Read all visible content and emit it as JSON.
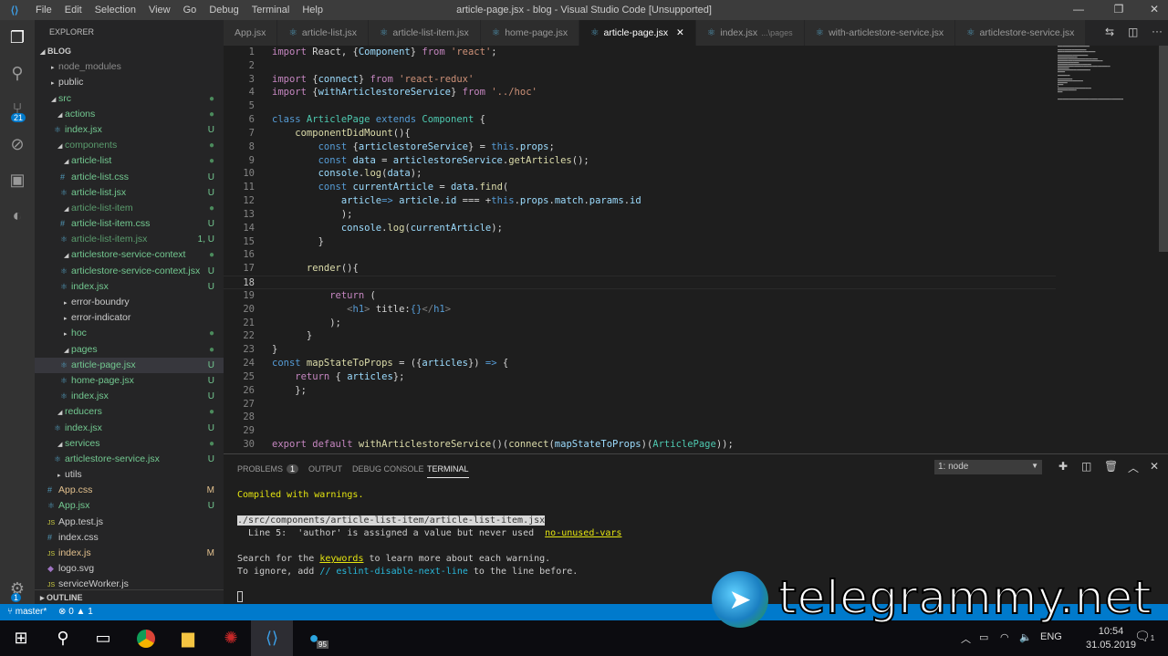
{
  "window": {
    "title": "article-page.jsx - blog - Visual Studio Code [Unsupported]",
    "menu": [
      "File",
      "Edit",
      "Selection",
      "View",
      "Go",
      "Debug",
      "Terminal",
      "Help"
    ]
  },
  "activity": {
    "items": [
      "explorer-icon",
      "search-icon",
      "source-control-icon",
      "debug-icon",
      "extensions-icon",
      "git-icon"
    ],
    "scm_badge": "21",
    "settings_badge": "1"
  },
  "sidebar": {
    "title": "EXPLORER",
    "root": "BLOG",
    "outline": "OUTLINE",
    "tree": [
      {
        "name": "node_modules",
        "depth": 0,
        "kind": "closed",
        "color": "#8b8b8b"
      },
      {
        "name": "public",
        "depth": 0,
        "kind": "closed",
        "color": "#ccc"
      },
      {
        "name": "src",
        "depth": 0,
        "kind": "open",
        "color": "#73c991",
        "deco": "●"
      },
      {
        "name": "actions",
        "depth": 1,
        "kind": "open",
        "color": "#73c991",
        "deco": "●"
      },
      {
        "name": "index.jsx",
        "depth": 1,
        "kind": "react",
        "color": "#73c991",
        "deco": "U"
      },
      {
        "name": "components",
        "depth": 1,
        "kind": "open",
        "color": "#5a9c6d",
        "deco": "●"
      },
      {
        "name": "article-list",
        "depth": 2,
        "kind": "open",
        "color": "#73c991",
        "deco": "●"
      },
      {
        "name": "article-list.css",
        "depth": 2,
        "kind": "css",
        "color": "#73c991",
        "deco": "U"
      },
      {
        "name": "article-list.jsx",
        "depth": 2,
        "kind": "react",
        "color": "#73c991",
        "deco": "U"
      },
      {
        "name": "article-list-item",
        "depth": 2,
        "kind": "open",
        "color": "#5a9c6d",
        "deco": "●"
      },
      {
        "name": "article-list-item.css",
        "depth": 2,
        "kind": "css",
        "color": "#73c991",
        "deco": "U"
      },
      {
        "name": "article-list-item.jsx",
        "depth": 2,
        "kind": "react",
        "color": "#5a9c6d",
        "deco": "1, U"
      },
      {
        "name": "articlestore-service-context",
        "depth": 2,
        "kind": "open",
        "color": "#73c991",
        "deco": "●"
      },
      {
        "name": "articlestore-service-context.jsx",
        "depth": 2,
        "kind": "react",
        "color": "#73c991",
        "deco": "U"
      },
      {
        "name": "index.jsx",
        "depth": 2,
        "kind": "react",
        "color": "#73c991",
        "deco": "U"
      },
      {
        "name": "error-boundry",
        "depth": 2,
        "kind": "closed",
        "color": "#ccc"
      },
      {
        "name": "error-indicator",
        "depth": 2,
        "kind": "closed",
        "color": "#ccc"
      },
      {
        "name": "hoc",
        "depth": 2,
        "kind": "closed",
        "color": "#73c991",
        "deco": "●"
      },
      {
        "name": "pages",
        "depth": 2,
        "kind": "open",
        "color": "#73c991",
        "deco": "●"
      },
      {
        "name": "article-page.jsx",
        "depth": 2,
        "kind": "react",
        "color": "#73c991",
        "deco": "U",
        "selected": true
      },
      {
        "name": "home-page.jsx",
        "depth": 2,
        "kind": "react",
        "color": "#73c991",
        "deco": "U"
      },
      {
        "name": "index.jsx",
        "depth": 2,
        "kind": "react",
        "color": "#73c991",
        "deco": "U"
      },
      {
        "name": "reducers",
        "depth": 1,
        "kind": "open",
        "color": "#73c991",
        "deco": "●"
      },
      {
        "name": "index.jsx",
        "depth": 1,
        "kind": "react",
        "color": "#73c991",
        "deco": "U"
      },
      {
        "name": "services",
        "depth": 1,
        "kind": "open",
        "color": "#73c991",
        "deco": "●"
      },
      {
        "name": "articlestore-service.jsx",
        "depth": 1,
        "kind": "react",
        "color": "#73c991",
        "deco": "U"
      },
      {
        "name": "utils",
        "depth": 1,
        "kind": "closed",
        "color": "#ccc"
      },
      {
        "name": "App.css",
        "depth": 0,
        "kind": "css",
        "color": "#e2c08d",
        "deco": "M"
      },
      {
        "name": "App.jsx",
        "depth": 0,
        "kind": "react",
        "color": "#73c991",
        "deco": "U"
      },
      {
        "name": "App.test.js",
        "depth": 0,
        "kind": "js",
        "color": "#ccc"
      },
      {
        "name": "index.css",
        "depth": 0,
        "kind": "css",
        "color": "#ccc"
      },
      {
        "name": "index.js",
        "depth": 0,
        "kind": "js",
        "color": "#e2c08d",
        "deco": "M"
      },
      {
        "name": "logo.svg",
        "depth": 0,
        "kind": "svg",
        "color": "#ccc"
      },
      {
        "name": "serviceWorker.js",
        "depth": 0,
        "kind": "js",
        "color": "#ccc"
      }
    ]
  },
  "tabs": [
    {
      "label": "App.jsx"
    },
    {
      "label": "article-list.jsx"
    },
    {
      "label": "article-list-item.jsx"
    },
    {
      "label": "home-page.jsx"
    },
    {
      "label": "article-page.jsx",
      "active": true
    },
    {
      "label": "index.jsx",
      "desc": "...\\pages"
    },
    {
      "label": "with-articlestore-service.jsx"
    },
    {
      "label": "articlestore-service.jsx"
    }
  ],
  "editor": {
    "current_line": 18,
    "lines": [
      [
        [
          "import",
          "k"
        ],
        [
          " React, {",
          "p"
        ],
        [
          "Component",
          "v"
        ],
        [
          "} ",
          "p"
        ],
        [
          "from",
          "k"
        ],
        [
          " 'react'",
          "s"
        ],
        [
          ";",
          "p"
        ]
      ],
      [],
      [
        [
          "import",
          "k"
        ],
        [
          " {",
          "p"
        ],
        [
          "connect",
          "v"
        ],
        [
          "} ",
          "p"
        ],
        [
          "from",
          "k"
        ],
        [
          " 'react-redux'",
          "s"
        ]
      ],
      [
        [
          "import",
          "k"
        ],
        [
          " {",
          "p"
        ],
        [
          "withArticlestoreService",
          "v"
        ],
        [
          "} ",
          "p"
        ],
        [
          "from",
          "k"
        ],
        [
          " '../hoc'",
          "s"
        ]
      ],
      [],
      [
        [
          "class",
          "b"
        ],
        [
          " ArticlePage ",
          "c"
        ],
        [
          "extends",
          "b"
        ],
        [
          " Component",
          "c"
        ],
        [
          " {",
          "p"
        ]
      ],
      [
        [
          "    componentDidMount",
          "f"
        ],
        [
          "(){",
          "p"
        ]
      ],
      [
        [
          "        const",
          "b"
        ],
        [
          " {",
          "p"
        ],
        [
          "articlestoreService",
          "v"
        ],
        [
          "} = ",
          "p"
        ],
        [
          "this",
          "b"
        ],
        [
          ".",
          "p"
        ],
        [
          "props",
          "v"
        ],
        [
          ";",
          "p"
        ]
      ],
      [
        [
          "        const",
          "b"
        ],
        [
          " data",
          "v"
        ],
        [
          " = ",
          "p"
        ],
        [
          "articlestoreService",
          "v"
        ],
        [
          ".",
          "p"
        ],
        [
          "getArticles",
          "f"
        ],
        [
          "();",
          "p"
        ]
      ],
      [
        [
          "        console",
          "v"
        ],
        [
          ".",
          "p"
        ],
        [
          "log",
          "f"
        ],
        [
          "(",
          "p"
        ],
        [
          "data",
          "v"
        ],
        [
          ");",
          "p"
        ]
      ],
      [
        [
          "        const",
          "b"
        ],
        [
          " currentArticle",
          "v"
        ],
        [
          " = ",
          "p"
        ],
        [
          "data",
          "v"
        ],
        [
          ".",
          "p"
        ],
        [
          "find",
          "f"
        ],
        [
          "(",
          "p"
        ]
      ],
      [
        [
          "            article",
          "v"
        ],
        [
          "=>",
          "b"
        ],
        [
          " article",
          "v"
        ],
        [
          ".",
          "p"
        ],
        [
          "id",
          "v"
        ],
        [
          " === +",
          "p"
        ],
        [
          "this",
          "b"
        ],
        [
          ".",
          "p"
        ],
        [
          "props",
          "v"
        ],
        [
          ".",
          "p"
        ],
        [
          "match",
          "v"
        ],
        [
          ".",
          "p"
        ],
        [
          "params",
          "v"
        ],
        [
          ".",
          "p"
        ],
        [
          "id",
          "v"
        ]
      ],
      [
        [
          "            );",
          "p"
        ]
      ],
      [
        [
          "            console",
          "v"
        ],
        [
          ".",
          "p"
        ],
        [
          "log",
          "f"
        ],
        [
          "(",
          "p"
        ],
        [
          "currentArticle",
          "v"
        ],
        [
          ");",
          "p"
        ]
      ],
      [
        [
          "        }",
          "p"
        ]
      ],
      [],
      [
        [
          "      render",
          "f"
        ],
        [
          "(){",
          "p"
        ]
      ],
      [],
      [
        [
          "          return",
          "k"
        ],
        [
          " (",
          "p"
        ]
      ],
      [
        [
          "             <",
          "t"
        ],
        [
          "h1",
          "b"
        ],
        [
          "> ",
          "t"
        ],
        [
          "title:",
          "p"
        ],
        [
          "{}",
          "b"
        ],
        [
          "</",
          "t"
        ],
        [
          "h1",
          "b"
        ],
        [
          ">",
          "t"
        ]
      ],
      [
        [
          "          );",
          "p"
        ]
      ],
      [
        [
          "      }",
          "p"
        ]
      ],
      [
        [
          "}",
          "p"
        ]
      ],
      [
        [
          "const",
          "b"
        ],
        [
          " mapStateToProps",
          "f"
        ],
        [
          " = ({",
          "p"
        ],
        [
          "articles",
          "v"
        ],
        [
          "}) ",
          "p"
        ],
        [
          "=>",
          "b"
        ],
        [
          " {",
          "p"
        ]
      ],
      [
        [
          "    return",
          "k"
        ],
        [
          " { ",
          "p"
        ],
        [
          "articles",
          "v"
        ],
        [
          "};",
          "p"
        ]
      ],
      [
        [
          "    };",
          "p"
        ]
      ],
      [],
      [],
      [],
      [
        [
          "export",
          "k"
        ],
        [
          " default",
          "k"
        ],
        [
          " withArticlestoreService",
          "f"
        ],
        [
          "()(",
          "p"
        ],
        [
          "connect",
          "f"
        ],
        [
          "(",
          "p"
        ],
        [
          "mapStateToProps",
          "v"
        ],
        [
          ")(",
          "p"
        ],
        [
          "ArticlePage",
          "c"
        ],
        [
          "));",
          "p"
        ]
      ]
    ]
  },
  "panel": {
    "tabs": [
      "PROBLEMS",
      "OUTPUT",
      "DEBUG CONSOLE",
      "TERMINAL"
    ],
    "problems_count": "1",
    "terminal_select": "1: node",
    "term": {
      "compiled": "Compiled with warnings.",
      "path": "./src/components/article-list-item/article-list-item.jsx",
      "warn": "  Line 5:  'author' is assigned a value but never used  ",
      "rule": "no-unused-vars",
      "search_a": "Search for the ",
      "keywords": "keywords",
      "search_b": " to learn more about each warning.",
      "ignore_a": "To ignore, add ",
      "ignore_code": "// eslint-disable-next-line",
      "ignore_b": " to the line before."
    }
  },
  "status": {
    "branch": "master*",
    "errors": "0",
    "warnings": "1"
  },
  "taskbar": {
    "apps": [
      "windows-start-icon",
      "search-icon",
      "task-view-icon",
      "chrome-icon",
      "file-explorer-icon",
      "app-icon",
      "vscode-icon",
      "telegram-icon"
    ],
    "telegram_badge": "95",
    "lang": "ENG",
    "time": "10:54",
    "date": "31.05.2019",
    "notif": "1"
  },
  "watermark": "telegrammy.net",
  "colors": {
    "accent": "#007acc",
    "untracked": "#73c991",
    "modified": "#e2c08d"
  }
}
